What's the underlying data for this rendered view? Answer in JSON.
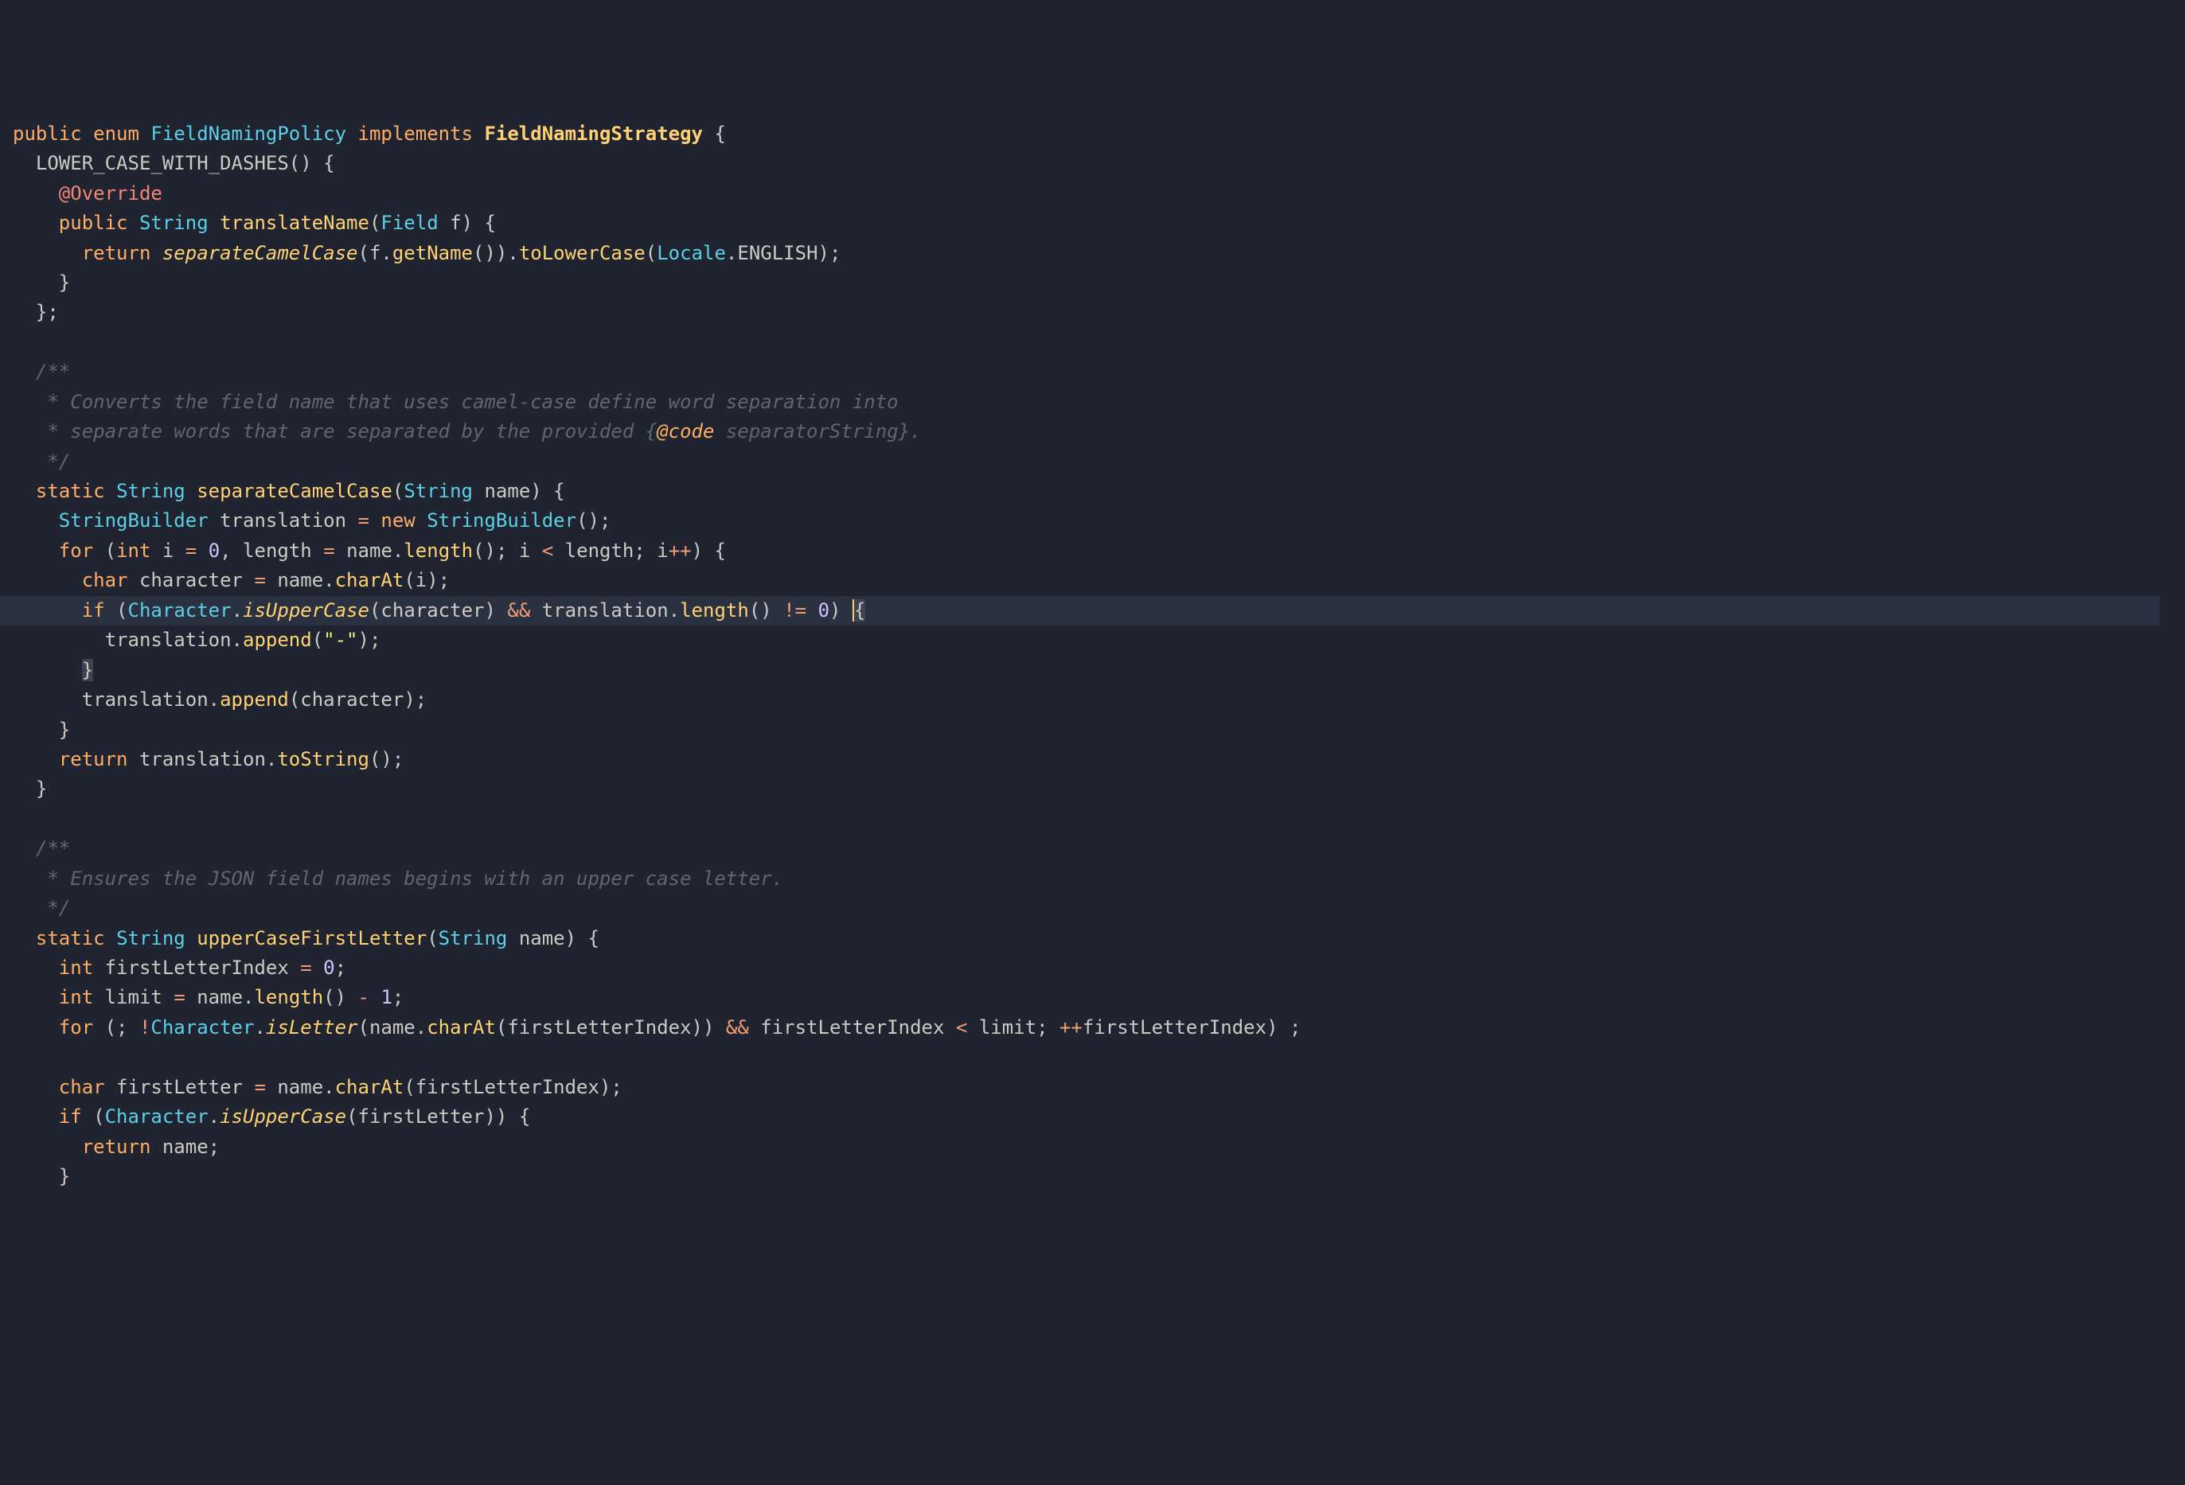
{
  "code": {
    "line1": {
      "public": "public",
      "enum": "enum",
      "className": "FieldNamingPolicy",
      "implements": "implements",
      "interface": "FieldNamingStrategy",
      "brace": "{"
    },
    "line2": {
      "constant": "LOWER_CASE_WITH_DASHES",
      "parens": "()",
      "brace": " {"
    },
    "line3": {
      "annotation": "@Override"
    },
    "line4": {
      "public": "public",
      "returnType": "String",
      "methodName": "translateName",
      "paramType": "Field",
      "paramName": "f",
      "brace": " {"
    },
    "line5": {
      "return": "return",
      "method1": "separateCamelCase",
      "f": "f",
      "getName": "getName",
      "toLowerCase": "toLowerCase",
      "locale": "Locale",
      "english": "ENGLISH"
    },
    "line6": {
      "brace": "}"
    },
    "line7": {
      "brace": "};"
    },
    "line8": "",
    "line9": {
      "comment": "/**"
    },
    "line10": {
      "comment": " * Converts the field name that uses camel-case define word separation into"
    },
    "line11": {
      "comment1": " * separate words that are separated by the provided {",
      "tag": "@code",
      "comment2": " separatorString}."
    },
    "line12": {
      "comment": " */"
    },
    "line13": {
      "static": "static",
      "returnType": "String",
      "methodName": "separateCamelCase",
      "paramType": "String",
      "paramName": "name",
      "brace": " {"
    },
    "line14": {
      "type": "StringBuilder",
      "varName": "translation",
      "equals": "=",
      "new": "new",
      "ctor": "StringBuilder"
    },
    "line15": {
      "for": "for",
      "int1": "int",
      "i": "i",
      "zero": "0",
      "length": "length",
      "name": "name",
      "lengthCall": "length",
      "lt": "<",
      "inc": "++",
      "brace": " {"
    },
    "line16": {
      "char": "char",
      "varName": "character",
      "name": "name",
      "charAt": "charAt",
      "i": "i"
    },
    "line17": {
      "if": "if",
      "character": "Character",
      "isUpperCase": "isUpperCase",
      "charVar": "character",
      "and": "&&",
      "translation": "translation",
      "length": "length",
      "ne": "!=",
      "zero": "0",
      "brace": "{"
    },
    "line18": {
      "translation": "translation",
      "append": "append",
      "dash": "\"-\""
    },
    "line19": {
      "brace": "}"
    },
    "line20": {
      "translation": "translation",
      "append": "append",
      "character": "character"
    },
    "line21": {
      "brace": "}"
    },
    "line22": {
      "return": "return",
      "translation": "translation",
      "toString": "toString"
    },
    "line23": {
      "brace": "}"
    },
    "line24": "",
    "line25": {
      "comment": "/**"
    },
    "line26": {
      "comment": " * Ensures the JSON field names begins with an upper case letter."
    },
    "line27": {
      "comment": " */"
    },
    "line28": {
      "static": "static",
      "returnType": "String",
      "methodName": "upperCaseFirstLetter",
      "paramType": "String",
      "paramName": "name",
      "brace": " {"
    },
    "line29": {
      "int": "int",
      "varName": "firstLetterIndex",
      "zero": "0"
    },
    "line30": {
      "int": "int",
      "varName": "limit",
      "name": "name",
      "length": "length",
      "minus": "-",
      "one": "1"
    },
    "line31": {
      "for": "for",
      "not": "!",
      "character": "Character",
      "isLetter": "isLetter",
      "name": "name",
      "charAt": "charAt",
      "fli": "firstLetterIndex",
      "and": "&&",
      "lt": "<",
      "limit": "limit",
      "inc": "++"
    },
    "line32": "",
    "line33": {
      "char": "char",
      "varName": "firstLetter",
      "name": "name",
      "charAt": "charAt",
      "fli": "firstLetterIndex"
    },
    "line34": {
      "if": "if",
      "character": "Character",
      "isUpperCase": "isUpperCase",
      "firstLetter": "firstLetter",
      "brace": " {"
    },
    "line35": {
      "return": "return",
      "name": "name"
    },
    "line36": {
      "brace": "}"
    }
  }
}
